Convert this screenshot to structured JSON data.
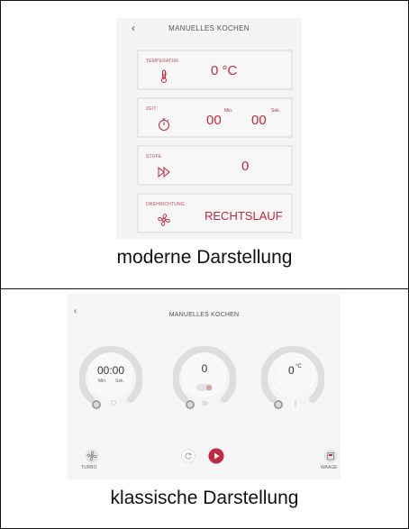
{
  "modern": {
    "back_icon": "chevron-left-icon",
    "title": "MANUELLES KOCHEN",
    "temperature": {
      "label": "TEMPERATUR",
      "value": "0 °C",
      "icon": "thermometer-icon"
    },
    "time": {
      "label": "ZEIT",
      "minutes": "00",
      "seconds": "00",
      "min_label": "Min.",
      "sec_label": "Sek.",
      "icon": "stopwatch-icon"
    },
    "level": {
      "label": "STUFE",
      "value": "0",
      "icon": "fast-forward-icon"
    },
    "direction": {
      "label": "DREHRICHTUNG",
      "value": "RECHTSLAUF",
      "icon": "fan-icon"
    },
    "caption": "moderne Darstellung"
  },
  "classic": {
    "back_icon": "chevron-left-icon",
    "title": "MANUELLES KOCHEN",
    "time_dial": {
      "value": "00:00",
      "min_label": "Min.",
      "sec_label": "Sek."
    },
    "level_dial": {
      "value": "0"
    },
    "temp_dial": {
      "value": "0",
      "unit": "°C"
    },
    "turbo_label": "TURBO",
    "scale_label": "WAAGE",
    "caption": "klassische Darstellung"
  },
  "colors": {
    "accent": "#c4283f",
    "panel": "#f5f5f5"
  }
}
